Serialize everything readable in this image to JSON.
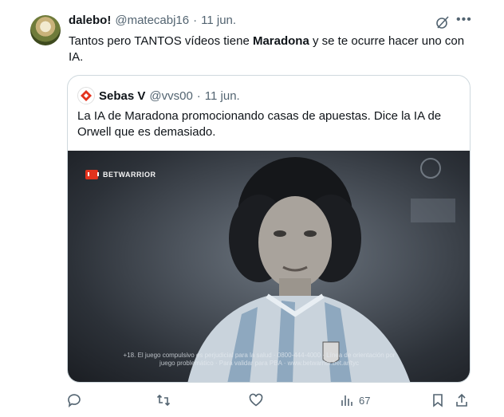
{
  "tweet": {
    "author_name": "dalebo!",
    "author_handle": "@matecabj16",
    "separator": "·",
    "date": "11 jun.",
    "text_before": "Tantos pero TANTOS vídeos tiene ",
    "text_bold": "Maradona",
    "text_after": " y se te ocurre hacer uno con IA.",
    "icons": {
      "grok": "grok-icon",
      "more": "more-icon"
    }
  },
  "quote": {
    "author_name": "Sebas V",
    "author_handle": "@vvs00",
    "separator": "·",
    "date": "11 jun.",
    "text": "La IA de Maradona promocionando casas de apuestas. Dice la IA de Orwell que es demasiado.",
    "media": {
      "brand": "BETWARRIOR",
      "brand_color": "#e3331d",
      "disclaimer": "+18. El juego compulsivo es perjudicial para la salud · 0800-444-4000 · Línea de orientación por juego problemático · Para validar para PBA · www.betwarrior.bet.ar/tyc"
    }
  },
  "actions": {
    "views": "67",
    "icons": [
      "reply-icon",
      "retweet-icon",
      "like-icon",
      "views-icon",
      "bookmark-icon",
      "share-icon"
    ]
  },
  "colors": {
    "text": "#0f1419",
    "secondary": "#536471",
    "border": "#cfd9de"
  }
}
